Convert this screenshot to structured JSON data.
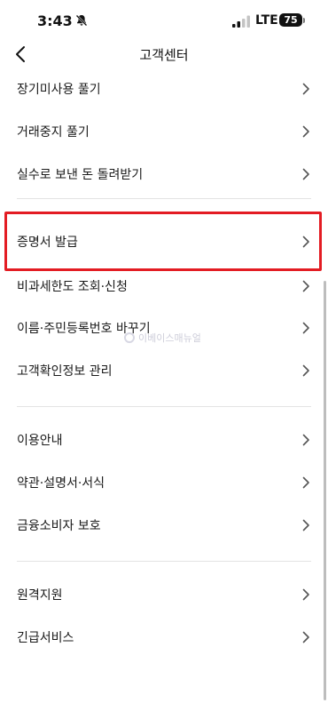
{
  "status_bar": {
    "time": "3:43",
    "network": "LTE",
    "battery": "75"
  },
  "header": {
    "title": "고객센터"
  },
  "menu": {
    "items": [
      {
        "label": "장기미사용 풀기"
      },
      {
        "label": "거래중지 풀기"
      },
      {
        "label": "실수로 보낸 돈 돌려받기"
      },
      {
        "label": "증명서 발급"
      },
      {
        "label": "비과세한도 조회·신청"
      },
      {
        "label": "이름·주민등록번호 바꾸기"
      },
      {
        "label": "고객확인정보 관리"
      },
      {
        "label": "이용안내"
      },
      {
        "label": "약관·설명서·서식"
      },
      {
        "label": "금융소비자 보호"
      },
      {
        "label": "원격지원"
      },
      {
        "label": "긴급서비스"
      }
    ]
  },
  "watermark": {
    "text": "이베이스매뉴얼"
  },
  "colors": {
    "highlight": "#e31c23",
    "text": "#1a1a1a",
    "divider": "#e3e3e3"
  }
}
